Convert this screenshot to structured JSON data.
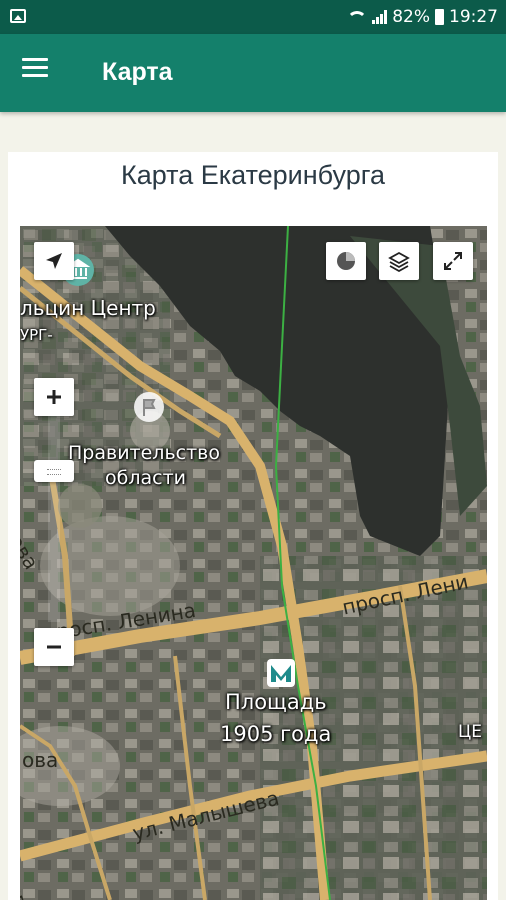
{
  "status_bar": {
    "battery": "82%",
    "time": "19:27"
  },
  "app_bar": {
    "title": "Карта"
  },
  "page": {
    "title": "Карта Екатеринбурга"
  },
  "map": {
    "labels": {
      "poi_center": "льцин Центр",
      "poi_urg": "УРГ-",
      "government_line1": "Правительство",
      "government_line2": "области",
      "street_kova": "кова",
      "street_lenina_left": "просп. Ленина",
      "street_lenina_right": "просп. Лени",
      "street_malysheva": "ул. Малышева",
      "street_ova": "ова",
      "street_ul": "ул",
      "metro_line1": "Площадь",
      "metro_line2": "1905 года",
      "cen": "ЦЕ"
    }
  },
  "colors": {
    "status_bar": "#0c5b4a",
    "app_bar": "#14806b",
    "road": "#d8b26c",
    "metro": "#1e8b8b",
    "route_line": "#3cb043"
  }
}
